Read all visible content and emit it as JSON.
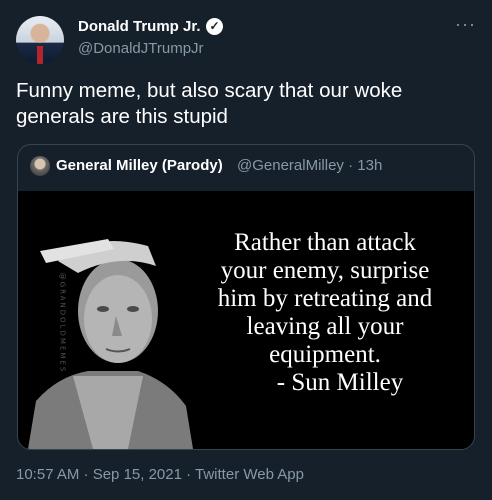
{
  "author": {
    "name": "Donald Trump Jr.",
    "handle": "@DonaldJTrumpJr",
    "verified_icon": "verified-badge-icon"
  },
  "menu": {
    "more_label": "···"
  },
  "tweet": {
    "text": "Funny meme, but also scary that our woke generals are this stupid"
  },
  "quoted": {
    "name": "General Milley (Parody)",
    "handle_time": "@GeneralMilley · 13h",
    "meme": {
      "watermark": "@GRANDOLDMEMES",
      "lines": [
        "Rather than attack",
        "your enemy, surprise",
        "him by retreating and",
        "leaving all your",
        "equipment.",
        "- Sun Milley"
      ]
    }
  },
  "footer": {
    "meta": "10:57 AM · Sep 15, 2021 · Twitter Web App"
  },
  "colors": {
    "background": "#15202b",
    "secondary_text": "#8899a6",
    "border": "#38444d"
  }
}
